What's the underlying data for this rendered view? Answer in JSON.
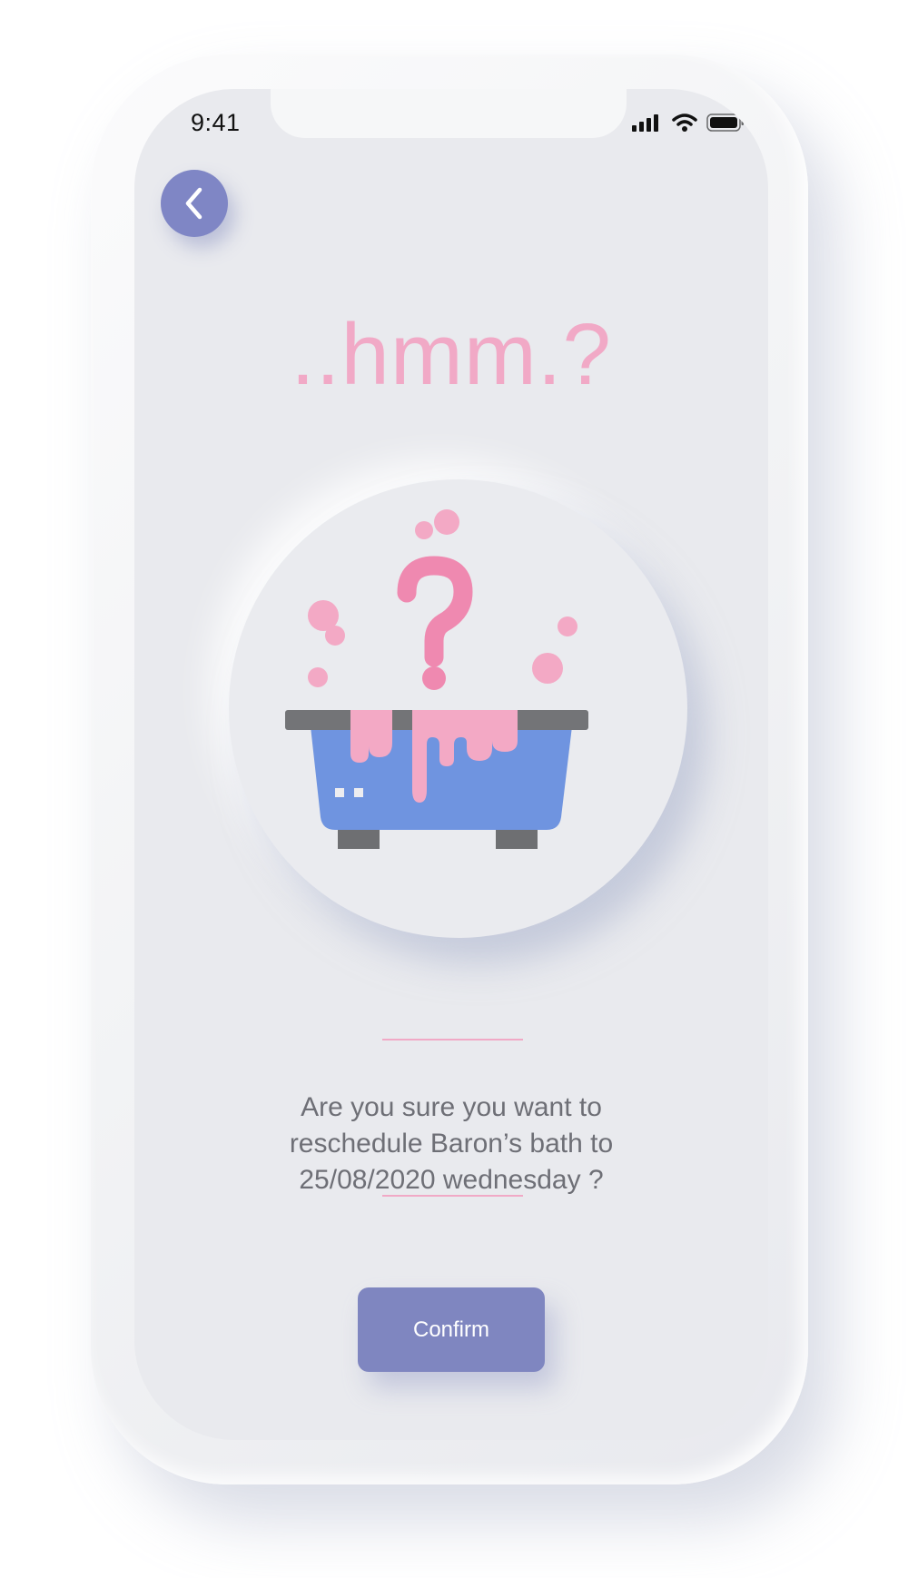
{
  "status_bar": {
    "time": "9:41",
    "icons": [
      "signal-icon",
      "wifi-icon",
      "battery-icon"
    ]
  },
  "header": {
    "back_icon": "chevron-left-icon"
  },
  "main": {
    "headline": "..hmm.?",
    "illustration": "bathtub-question-icon",
    "message_lines": [
      "Are you sure you want to",
      "reschedule Baron’s bath to",
      "25/08/2020 wednesday ?"
    ],
    "confirm_label": "Confirm"
  },
  "colors": {
    "accent": "#7f86c0",
    "pink": "#f1a9c6",
    "background": "#e9eaee",
    "tub_blue": "#6f94e0"
  }
}
